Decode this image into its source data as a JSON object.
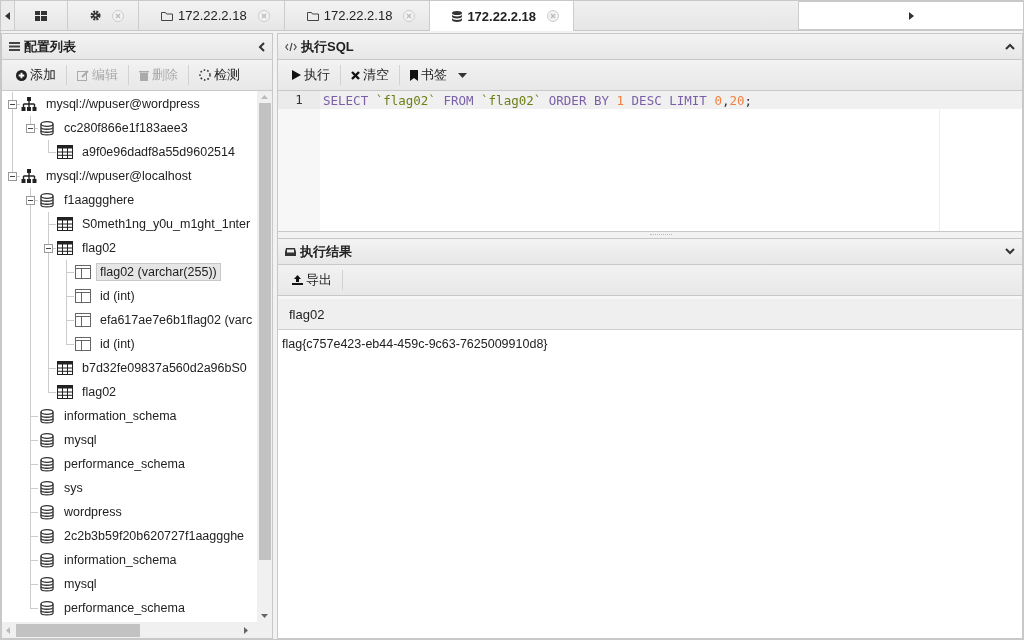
{
  "tabs": [
    {
      "kind": "home",
      "selected": false
    },
    {
      "kind": "settings",
      "selected": false,
      "closable": true
    },
    {
      "kind": "folder",
      "label": "172.22.2.18",
      "selected": false,
      "closable": true
    },
    {
      "kind": "folder",
      "label": "172.22.2.18",
      "selected": false,
      "closable": true
    },
    {
      "kind": "database",
      "label": "172.22.2.18",
      "selected": true,
      "closable": true
    }
  ],
  "sidebar": {
    "title": "配置列表",
    "toolbar": [
      {
        "kind": "add",
        "label": "添加",
        "disabled": false
      },
      {
        "kind": "edit",
        "label": "编辑",
        "disabled": true
      },
      {
        "kind": "delete",
        "label": "删除",
        "disabled": true
      },
      {
        "kind": "check",
        "label": "检测",
        "disabled": false
      }
    ],
    "tree": [
      {
        "kind": "connection",
        "label": "mysql://wpuser@wordpress",
        "expanded": true,
        "selected": false,
        "children": [
          {
            "kind": "database",
            "label": "cc280f866e1f183aee3",
            "expanded": true,
            "selected": false,
            "children": [
              {
                "kind": "table",
                "label": "a9f0e96dadf8a55d9602514",
                "selected": false
              }
            ]
          }
        ]
      },
      {
        "kind": "connection",
        "label": "mysql://wpuser@localhost",
        "expanded": true,
        "selected": false,
        "children": [
          {
            "kind": "database",
            "label": "f1aaggghere",
            "expanded": true,
            "selected": false,
            "children": [
              {
                "kind": "table",
                "label": "S0meth1ng_y0u_m1ght_1nter",
                "selected": false
              },
              {
                "kind": "table",
                "label": "flag02",
                "expanded": true,
                "selected": false,
                "children": [
                  {
                    "kind": "column",
                    "label": "flag02 (varchar(255))",
                    "selected": true
                  },
                  {
                    "kind": "column",
                    "label": "id (int)",
                    "selected": false
                  },
                  {
                    "kind": "column",
                    "label": "efa617ae7e6b1flag02 (varc",
                    "selected": false
                  },
                  {
                    "kind": "column",
                    "label": "id (int)",
                    "selected": false
                  }
                ]
              },
              {
                "kind": "table",
                "label": "b7d32fe09837a560d2a96bS0",
                "selected": false
              },
              {
                "kind": "table",
                "label": "flag02",
                "selected": false
              }
            ]
          },
          {
            "kind": "database",
            "label": "information_schema",
            "selected": false
          },
          {
            "kind": "database",
            "label": "mysql",
            "selected": false
          },
          {
            "kind": "database",
            "label": "performance_schema",
            "selected": false
          },
          {
            "kind": "database",
            "label": "sys",
            "selected": false
          },
          {
            "kind": "database",
            "label": "wordpress",
            "selected": false
          },
          {
            "kind": "database",
            "label": "2c2b3b59f20b620727f1aaggghe",
            "selected": false
          },
          {
            "kind": "database",
            "label": "information_schema",
            "selected": false
          },
          {
            "kind": "database",
            "label": "mysql",
            "selected": false
          },
          {
            "kind": "database",
            "label": "performance_schema",
            "selected": false
          }
        ]
      }
    ]
  },
  "sql_panel": {
    "title": "执行SQL",
    "toolbar": [
      {
        "kind": "run",
        "label": "执行"
      },
      {
        "kind": "clear",
        "label": "清空"
      },
      {
        "kind": "bookmark",
        "label": "书签",
        "dropdown": true
      }
    ],
    "editor": {
      "lines": [
        {
          "number": "1",
          "tokens": [
            {
              "kind": "keyword",
              "text": "SELECT "
            },
            {
              "kind": "identifier",
              "text": "`flag02` "
            },
            {
              "kind": "keyword",
              "text": "FROM "
            },
            {
              "kind": "identifier",
              "text": "`flag02` "
            },
            {
              "kind": "keyword",
              "text": "ORDER BY "
            },
            {
              "kind": "number",
              "text": "1 "
            },
            {
              "kind": "keyword",
              "text": "DESC LIMIT "
            },
            {
              "kind": "number",
              "text": "0"
            },
            {
              "kind": "plain",
              "text": ","
            },
            {
              "kind": "number",
              "text": "20"
            },
            {
              "kind": "plain",
              "text": ";"
            }
          ]
        }
      ]
    }
  },
  "result_panel": {
    "title": "执行结果",
    "toolbar": [
      {
        "kind": "export",
        "label": "导出"
      }
    ],
    "columns": [
      "flag02"
    ],
    "rows": [
      [
        "flag{c757e423-eb44-459c-9c63-7625009910d8}"
      ]
    ]
  }
}
